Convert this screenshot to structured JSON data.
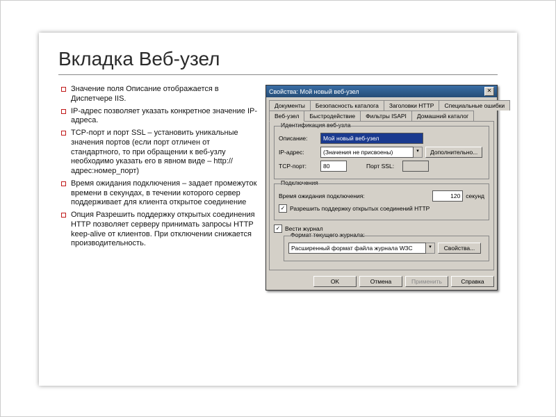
{
  "slide": {
    "title": "Вкладка Веб-узел",
    "bullets": [
      "Значение поля Описание отображается в Диспетчере IIS.",
      "IP-адрес позволяет указать конкретное значение IP-адреса.",
      "TCP-порт и порт SSL – установить уникальные значения портов (если порт отличен от стандартного, то при обращении к веб-узлу необходимо указать его в явном виде – http://адрес:номер_порт)",
      "Время ожидания подключения – задает промежуток времени в секундах, в течении которого сервер поддерживает для клиента открытое соединение",
      "Опция Разрешить поддержку открытых соединения HTTP позволяет серверу принимать запросы HTTP keep-alive от клиентов. При отключении снижается производительность."
    ]
  },
  "dialog": {
    "title": "Свойства: Мой новый веб-узел",
    "close": "✕",
    "tabs_row1": [
      "Документы",
      "Безопасность каталога",
      "Заголовки HTTP",
      "Специальные ошибки"
    ],
    "tabs_row2": [
      "Веб-узел",
      "Быстродействие",
      "Фильтры ISAPI",
      "Домашний каталог"
    ],
    "active_tab": "Веб-узел",
    "group_ident": {
      "title": "Идентификация веб-узла",
      "desc_label": "Описание:",
      "desc_value": "Мой новый веб-узел",
      "ip_label": "IP-адрес:",
      "ip_value": "(Значения не присвоены)",
      "advanced": "Дополнительно...",
      "tcp_label": "TCP-порт:",
      "tcp_value": "80",
      "ssl_label": "Порт SSL:",
      "ssl_value": ""
    },
    "group_conn": {
      "title": "Подключения",
      "timeout_label": "Время ожидания подключения:",
      "timeout_value": "120",
      "timeout_unit": "секунд",
      "keepalive": "Разрешить поддержку открытых соединений HTTP"
    },
    "log_check": "Вести журнал",
    "group_log": {
      "title": "Формат текущего журнала:",
      "format_value": "Расширенный формат файла журнала W3C",
      "props": "Свойства..."
    },
    "buttons": {
      "ok": "OK",
      "cancel": "Отмена",
      "apply": "Применить",
      "help": "Справка"
    }
  }
}
